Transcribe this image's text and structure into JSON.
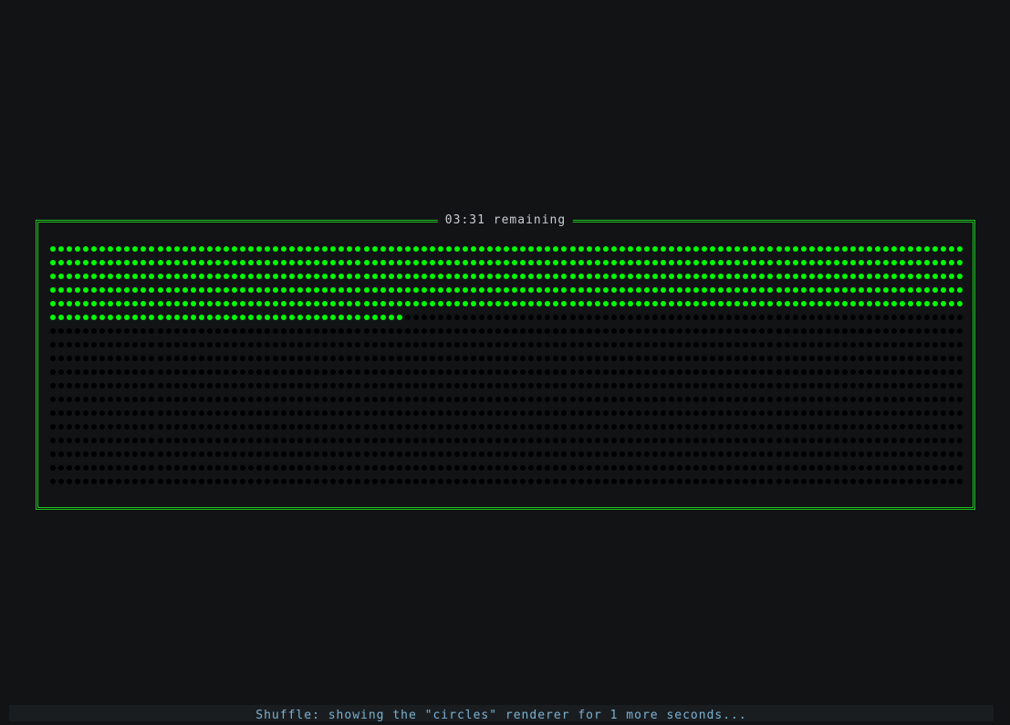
{
  "timer": {
    "label": "03:31 remaining"
  },
  "progress": {
    "renderer": "circles",
    "columns": 111,
    "rows": 18,
    "filled_dots": 598
  },
  "status": {
    "text": "Shuffle: showing the \"circles\" renderer for 1 more seconds..."
  },
  "colors": {
    "background": "#111315",
    "border": "#1fc21f",
    "dot_filled": "#00ff00",
    "dot_empty": "#000000",
    "label_text": "#c9ccd1",
    "status_text": "#7ab3d3"
  }
}
